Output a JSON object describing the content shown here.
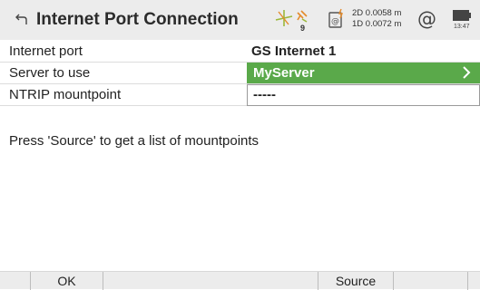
{
  "header": {
    "title": "Internet Port Connection",
    "satellites_count": "9",
    "quality_2d": "2D 0.0058 m",
    "quality_1d": "1D 0.0072 m",
    "clock": "13:47"
  },
  "rows": {
    "internet_port": {
      "label": "Internet port",
      "value": "GS Internet 1"
    },
    "server": {
      "label": "Server to use",
      "value": "MyServer"
    },
    "mountpoint": {
      "label": "NTRIP mountpoint",
      "value": "-----"
    }
  },
  "hint": "Press 'Source' to get a list of mountpoints",
  "softkeys": {
    "ok": "OK",
    "source": "Source"
  },
  "colors": {
    "accent_green": "#5aa94a",
    "titlebar_bg": "#ececec"
  }
}
